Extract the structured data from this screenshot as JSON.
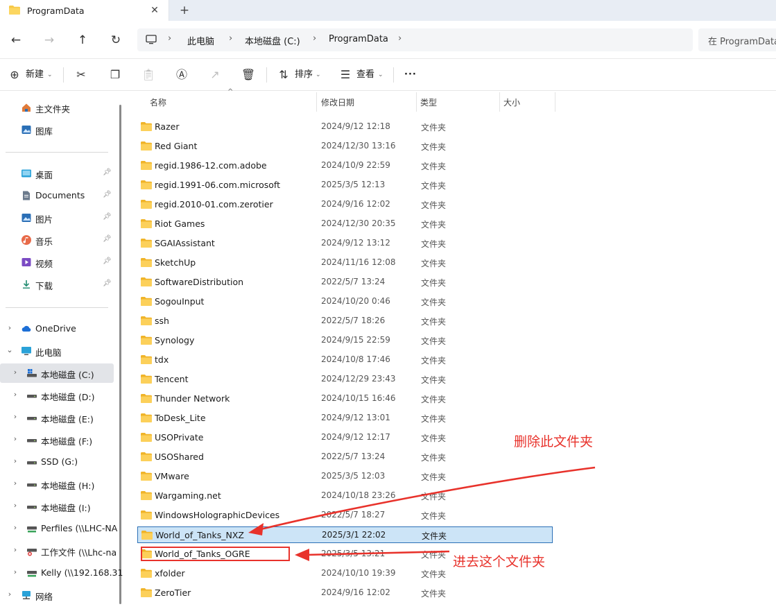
{
  "tab": {
    "title": "ProgramData",
    "close_glyph": "✕",
    "new_glyph": "+"
  },
  "nav": {
    "back": "←",
    "forward": "→",
    "up": "↑",
    "refresh": "↻"
  },
  "breadcrumb": [
    "此电脑",
    "本地磁盘 (C:)",
    "ProgramData"
  ],
  "breadcrumb_sep": "›",
  "search": {
    "placeholder": "在 ProgramData 中搜索"
  },
  "commands": {
    "new_label": "新建",
    "sort_label": "排序",
    "view_label": "查看",
    "more_label": "···",
    "icons": [
      "cut-icon",
      "copy-icon",
      "paste-icon",
      "rename-icon",
      "share-icon",
      "delete-icon"
    ]
  },
  "sidebar": {
    "quick": [
      {
        "label": "主文件夹",
        "icon": "home-icon"
      },
      {
        "label": "图库",
        "icon": "gallery-icon"
      }
    ],
    "pinned": [
      {
        "label": "桌面",
        "icon": "desktop-icon"
      },
      {
        "label": "Documents",
        "icon": "documents-icon"
      },
      {
        "label": "图片",
        "icon": "pictures-icon"
      },
      {
        "label": "音乐",
        "icon": "music-icon"
      },
      {
        "label": "视频",
        "icon": "videos-icon"
      },
      {
        "label": "下载",
        "icon": "downloads-icon"
      }
    ],
    "tree": [
      {
        "label": "OneDrive",
        "icon": "onedrive-icon",
        "chev": "›",
        "indent": 0
      },
      {
        "label": "此电脑",
        "icon": "this-pc-icon",
        "chev": "⌄",
        "indent": 0
      },
      {
        "label": "本地磁盘 (C:)",
        "icon": "system-drive-icon",
        "chev": "›",
        "indent": 1,
        "selected": true
      },
      {
        "label": "本地磁盘 (D:)",
        "icon": "drive-icon",
        "chev": "›",
        "indent": 1
      },
      {
        "label": "本地磁盘 (E:)",
        "icon": "drive-icon",
        "chev": "›",
        "indent": 1
      },
      {
        "label": "本地磁盘 (F:)",
        "icon": "drive-icon",
        "chev": "›",
        "indent": 1
      },
      {
        "label": "SSD (G:)",
        "icon": "drive-icon",
        "chev": "›",
        "indent": 1
      },
      {
        "label": "本地磁盘 (H:)",
        "icon": "drive-icon",
        "chev": "›",
        "indent": 1
      },
      {
        "label": "本地磁盘 (I:)",
        "icon": "drive-icon",
        "chev": "›",
        "indent": 1
      },
      {
        "label": "Perfiles (\\\\LHC-NA",
        "icon": "network-drive-icon",
        "chev": "›",
        "indent": 1
      },
      {
        "label": "工作文件 (\\\\Lhc-na",
        "icon": "disconnected-drive-icon",
        "chev": "›",
        "indent": 1
      },
      {
        "label": "Kelly (\\\\192.168.31",
        "icon": "network-drive-icon",
        "chev": "›",
        "indent": 1
      },
      {
        "label": "网络",
        "icon": "network-icon",
        "chev": "›",
        "indent": 0
      }
    ]
  },
  "columns": {
    "name": "名称",
    "date": "修改日期",
    "type": "类型",
    "size": "大小"
  },
  "files": [
    {
      "name": "Razer",
      "date": "2024/9/12 12:18",
      "type": "文件夹"
    },
    {
      "name": "Red Giant",
      "date": "2024/12/30 13:16",
      "type": "文件夹"
    },
    {
      "name": "regid.1986-12.com.adobe",
      "date": "2024/10/9 22:59",
      "type": "文件夹"
    },
    {
      "name": "regid.1991-06.com.microsoft",
      "date": "2025/3/5 12:13",
      "type": "文件夹"
    },
    {
      "name": "regid.2010-01.com.zerotier",
      "date": "2024/9/16 12:02",
      "type": "文件夹"
    },
    {
      "name": "Riot Games",
      "date": "2024/12/30 20:35",
      "type": "文件夹"
    },
    {
      "name": "SGAIAssistant",
      "date": "2024/9/12 13:12",
      "type": "文件夹"
    },
    {
      "name": "SketchUp",
      "date": "2024/11/16 12:08",
      "type": "文件夹"
    },
    {
      "name": "SoftwareDistribution",
      "date": "2022/5/7 13:24",
      "type": "文件夹"
    },
    {
      "name": "SogouInput",
      "date": "2024/10/20 0:46",
      "type": "文件夹"
    },
    {
      "name": "ssh",
      "date": "2022/5/7 18:26",
      "type": "文件夹"
    },
    {
      "name": "Synology",
      "date": "2024/9/15 22:59",
      "type": "文件夹"
    },
    {
      "name": "tdx",
      "date": "2024/10/8 17:46",
      "type": "文件夹"
    },
    {
      "name": "Tencent",
      "date": "2024/12/29 23:43",
      "type": "文件夹"
    },
    {
      "name": "Thunder Network",
      "date": "2024/10/15 16:46",
      "type": "文件夹"
    },
    {
      "name": "ToDesk_Lite",
      "date": "2024/9/12 13:01",
      "type": "文件夹"
    },
    {
      "name": "USOPrivate",
      "date": "2024/9/12 12:17",
      "type": "文件夹"
    },
    {
      "name": "USOShared",
      "date": "2022/5/7 13:24",
      "type": "文件夹"
    },
    {
      "name": "VMware",
      "date": "2025/3/5 12:03",
      "type": "文件夹"
    },
    {
      "name": "Wargaming.net",
      "date": "2024/10/18 23:26",
      "type": "文件夹"
    },
    {
      "name": "WindowsHolographicDevices",
      "date": "2022/5/7 18:27",
      "type": "文件夹"
    },
    {
      "name": "World_of_Tanks_NXZ",
      "date": "2025/3/1 22:02",
      "type": "文件夹",
      "selected": true
    },
    {
      "name": "World_of_Tanks_OGRE",
      "date": "2025/3/5 13:21",
      "type": "文件夹"
    },
    {
      "name": "xfolder",
      "date": "2024/10/10 19:39",
      "type": "文件夹"
    },
    {
      "name": "ZeroTier",
      "date": "2024/9/16 12:02",
      "type": "文件夹"
    }
  ],
  "annotations": {
    "delete_note": "删除此文件夹",
    "enter_note": "进去这个文件夹",
    "color": "#e8322b"
  },
  "colors": {
    "folder": "#f7c948",
    "selection": "#cce4f7",
    "accent": "#2b6fb6"
  }
}
